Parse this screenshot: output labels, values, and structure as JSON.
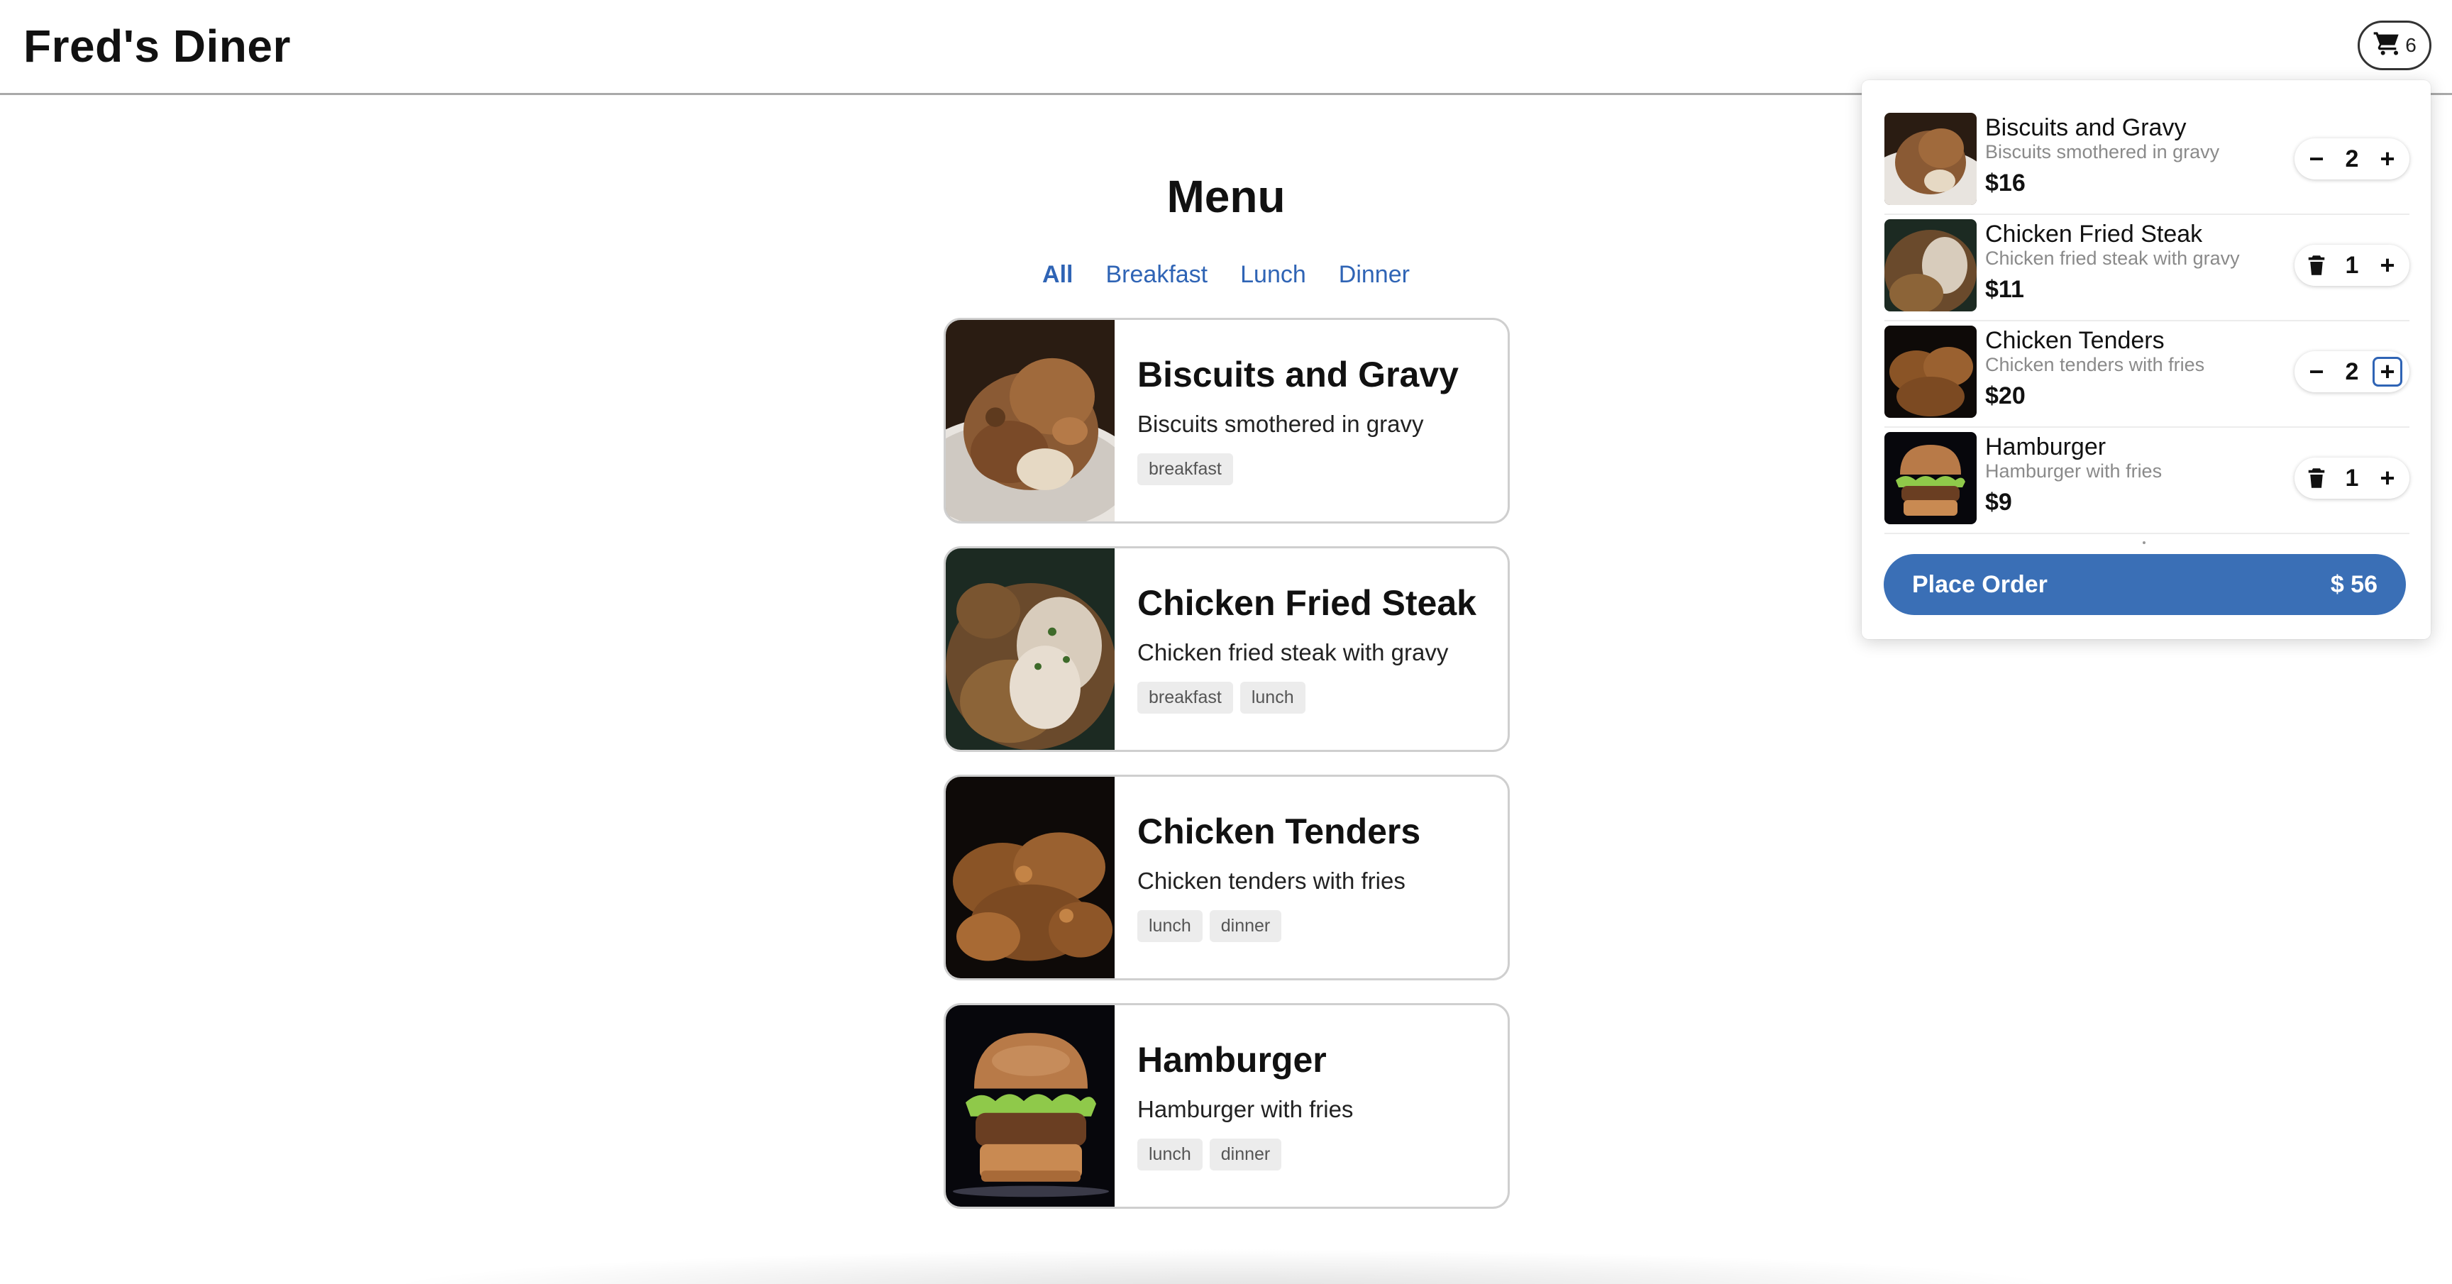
{
  "header": {
    "brand": "Fred's Diner",
    "cart_icon": "cart-icon",
    "cart_count": "6"
  },
  "menu": {
    "title": "Menu",
    "filters": [
      "All",
      "Breakfast",
      "Lunch",
      "Dinner"
    ],
    "active_filter": "All",
    "items": [
      {
        "title": "Biscuits and Gravy",
        "desc": "Biscuits smothered in gravy",
        "tags": [
          "breakfast"
        ]
      },
      {
        "title": "Chicken Fried Steak",
        "desc": "Chicken fried steak with gravy",
        "tags": [
          "breakfast",
          "lunch"
        ]
      },
      {
        "title": "Chicken Tenders",
        "desc": "Chicken tenders with fries",
        "tags": [
          "lunch",
          "dinner"
        ]
      },
      {
        "title": "Hamburger",
        "desc": "Hamburger with fries",
        "tags": [
          "lunch",
          "dinner"
        ]
      }
    ]
  },
  "cart": {
    "items": [
      {
        "name": "Biscuits and Gravy",
        "desc": "Biscuits smothered in gravy",
        "price": "$16",
        "qty": "2",
        "dec_icon": "minus-icon"
      },
      {
        "name": "Chicken Fried Steak",
        "desc": "Chicken fried steak with gravy",
        "price": "$11",
        "qty": "1",
        "dec_icon": "trash-icon"
      },
      {
        "name": "Chicken Tenders",
        "desc": "Chicken tenders with fries",
        "price": "$20",
        "qty": "2",
        "dec_icon": "minus-icon"
      },
      {
        "name": "Hamburger",
        "desc": "Hamburger with fries",
        "price": "$9",
        "qty": "1",
        "dec_icon": "trash-icon"
      }
    ],
    "place_order_label": "Place Order",
    "total": "$ 56"
  },
  "colors": {
    "accent": "#3a6fb6",
    "link": "#2f64b5"
  }
}
